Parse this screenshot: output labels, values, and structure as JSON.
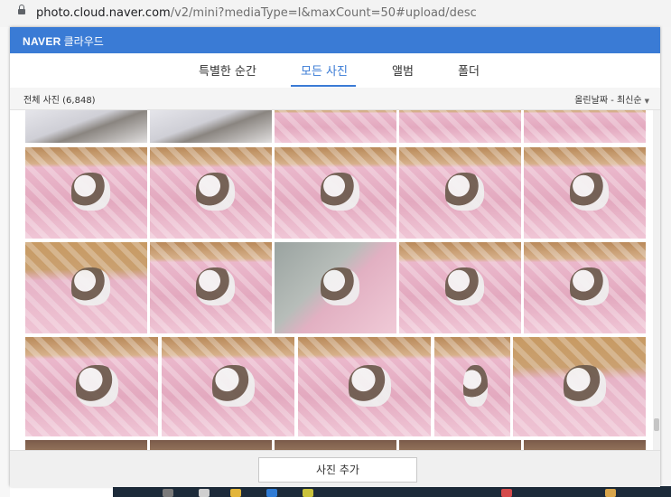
{
  "browser": {
    "url_domain": "photo.cloud.naver.com",
    "url_path": "/v2/mini?mediaType=I&maxCount=50#upload/desc"
  },
  "header": {
    "brand": "NAVER",
    "title": "클라우드"
  },
  "tabs": [
    {
      "label": "특별한 순간",
      "active": false
    },
    {
      "label": "모든 사진",
      "active": true
    },
    {
      "label": "앨범",
      "active": false
    },
    {
      "label": "폴더",
      "active": false
    }
  ],
  "infobar": {
    "count_label": "전체 사진 (6,848)",
    "sort_label": "올린날짜 - 최신순"
  },
  "footer": {
    "add_button": "사진 추가"
  },
  "photos": [
    {
      "tone": "white-blanket-kitten"
    },
    {
      "tone": "white-blanket-kitten"
    },
    {
      "tone": "pink-blanket-kitten"
    },
    {
      "tone": "pink-blanket-kitten"
    },
    {
      "tone": "pink-blanket-kitten"
    },
    {
      "tone": "pink-blanket-kitten"
    },
    {
      "tone": "pink-blanket-kitten"
    },
    {
      "tone": "pink-blanket-kitten"
    },
    {
      "tone": "pink-blanket-kitten"
    },
    {
      "tone": "pink-blanket-kitten"
    },
    {
      "tone": "wood-floor-kitten"
    },
    {
      "tone": "pink-blanket-kitten"
    },
    {
      "tone": "gray-cushion-kitten"
    },
    {
      "tone": "pink-blanket-kitten"
    },
    {
      "tone": "pink-blanket-kitten"
    },
    {
      "tone": "pink-blanket-kitten"
    },
    {
      "tone": "pink-blanket-kitten"
    },
    {
      "tone": "pink-blanket-kitten"
    },
    {
      "tone": "pink-blanket-kitten"
    },
    {
      "tone": "wood-floor-kitten"
    },
    {
      "tone": "dark-room"
    },
    {
      "tone": "dark-room"
    },
    {
      "tone": "dark-room"
    },
    {
      "tone": "dark-room"
    },
    {
      "tone": "dark-room"
    }
  ],
  "colors": {
    "brand_blue": "#3a7bd5",
    "tab_active": "#3a7bd5",
    "blanket_pink": "#e8b6c8"
  }
}
